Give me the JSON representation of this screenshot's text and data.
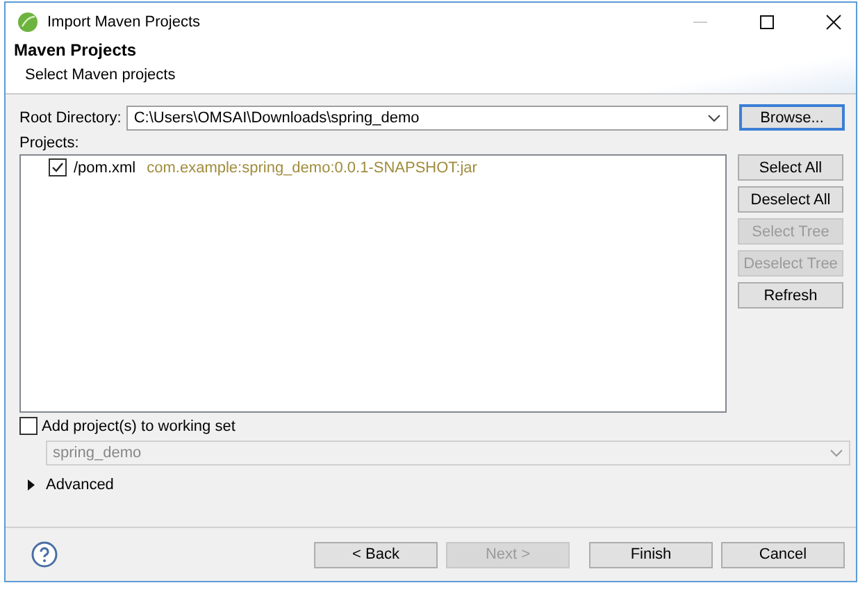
{
  "window": {
    "title": "Import Maven Projects"
  },
  "header": {
    "title": "Maven Projects",
    "subtitle": "Select Maven projects"
  },
  "root_directory": {
    "label": "Root Directory:",
    "value": "C:\\Users\\OMSAI\\Downloads\\spring_demo",
    "browse": {
      "label": "Browse...",
      "focused": true
    }
  },
  "projects": {
    "label": "Projects:",
    "items": [
      {
        "checked": true,
        "name": "/pom.xml",
        "detail": "com.example:spring_demo:0.0.1-SNAPSHOT:jar"
      }
    ]
  },
  "side_buttons": [
    {
      "label": "Select All",
      "disabled": false
    },
    {
      "label": "Deselect All",
      "disabled": false
    },
    {
      "label": "Select Tree",
      "disabled": true
    },
    {
      "label": "Deselect Tree",
      "disabled": true
    },
    {
      "label": "Refresh",
      "disabled": false
    }
  ],
  "working_set": {
    "label": "Add project(s) to working set",
    "checked": false,
    "value": "spring_demo",
    "disabled": true
  },
  "advanced": {
    "label": "Advanced",
    "expanded": false
  },
  "buttons": [
    {
      "label": "< Back",
      "disabled": false
    },
    {
      "label": "Next >",
      "disabled": true
    },
    {
      "label": "Finish",
      "disabled": false
    },
    {
      "label": "Cancel",
      "disabled": false
    }
  ]
}
